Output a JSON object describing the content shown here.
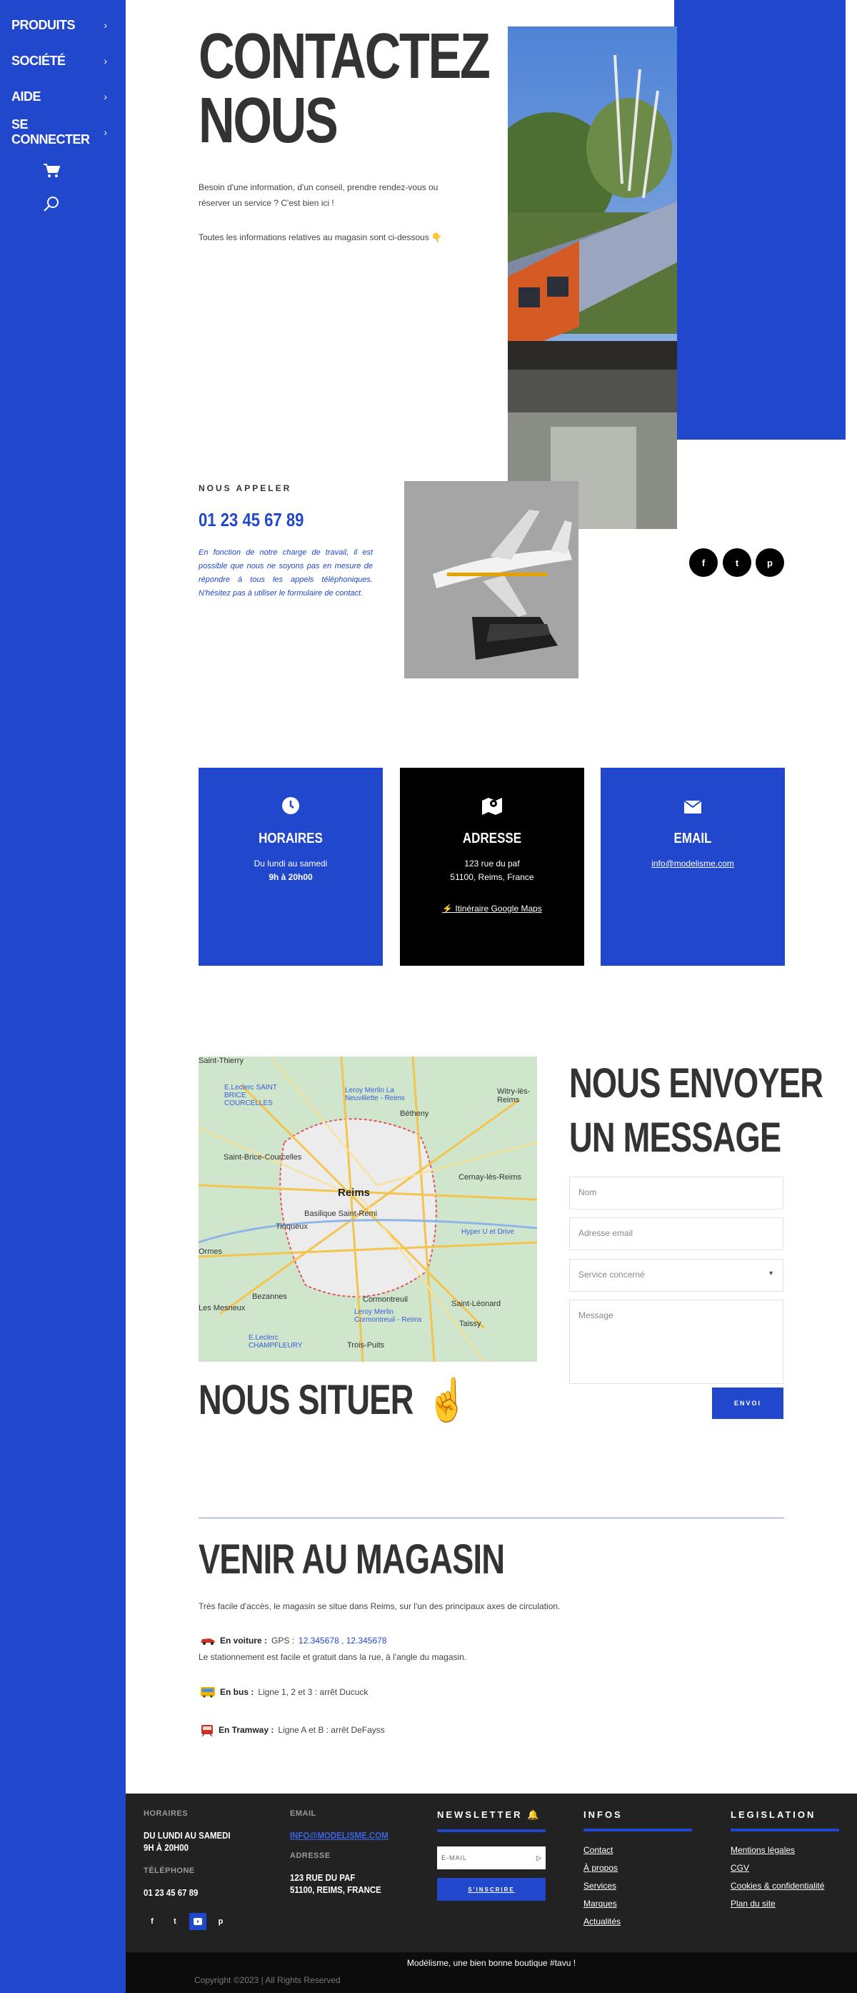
{
  "sidebar": {
    "items": [
      {
        "label": "PRODUITS"
      },
      {
        "label": "SOCIÉTÉ"
      },
      {
        "label": "AIDE"
      },
      {
        "label": "SE CONNECTER"
      }
    ],
    "chevron": "›",
    "icons": [
      "cart-icon",
      "search-icon"
    ]
  },
  "hero": {
    "title_line1": "CONTACTEZ",
    "title_line2": "NOUS",
    "intro_line1": "Besoin d'une information, d'un conseil, prendre rendez-vous ou",
    "intro_line2": "réserver un service ? C'est bien ici !",
    "info_line": "Toutes les informations relatives au magasin sont ci-dessous 👇"
  },
  "call": {
    "label": "NOUS APPELER",
    "phone": "01 23 45 67 89",
    "note": "En fonction de notre charge de travail, il est possible que nous ne soyons pas en mesure de répondre à tous les appels téléphoniques. N'hésitez pas à utiliser le formulaire de contact."
  },
  "social": [
    {
      "name": "facebook",
      "glyph": "f"
    },
    {
      "name": "twitter",
      "glyph": "t"
    },
    {
      "name": "pinterest",
      "glyph": "p"
    }
  ],
  "cards": {
    "horaires": {
      "title": "HORAIRES",
      "line1": "Du lundi au samedi",
      "line2": "9h à 20h00"
    },
    "adresse": {
      "title": "ADRESSE",
      "line1": "123 rue du paf",
      "line2": "51100, Reims, France",
      "link": "⚡ Itinéraire Google Maps"
    },
    "email": {
      "title": "EMAIL",
      "link": "info@modelisme.com"
    }
  },
  "map": {
    "labels": [
      "Saint-Thierry",
      "Witry-lès-Reims",
      "E.Leclerc SAINT BRICE COURCELLES",
      "Leroy Merlin La Neuvillette - Reims",
      "Bétheny",
      "Saint-Brice-Courcelles",
      "Reims",
      "Cernay-lès-Reims",
      "Basilique Saint-Remi",
      "Tinqueux",
      "Hyper U et Drive",
      "Ormes",
      "Bezannes",
      "Cormontreuil",
      "Saint-Léonard",
      "Les Mesneux",
      "Leroy Merlin Cormontreuil - Reims",
      "Taissy",
      "E.Leclerc CHAMPFLEURY",
      "Trois-Puits"
    ]
  },
  "contact_form": {
    "title_line1": "NOUS ENVOYER",
    "title_line2": "UN MESSAGE",
    "name_placeholder": "Nom",
    "email_placeholder": "Adresse email",
    "service_placeholder": "Service concerné",
    "message_placeholder": "Message",
    "submit": "ENVOI"
  },
  "situer": {
    "title": "NOUS SITUER",
    "emoji": "☝"
  },
  "venir": {
    "title": "VENIR AU MAGASIN",
    "intro": "Très facile d'accès, le magasin se situe dans Reims, sur l'un des principaux axes de circulation.",
    "car_label": "En voiture :",
    "car_gps": "GPS :",
    "car_coords": "12.345678 , 12.345678",
    "car_parking": "Le stationnement est facile et gratuit dans la rue, à l'angle du magasin.",
    "bus_label": "En bus :",
    "bus_text": "Ligne 1, 2 et 3 : arrêt Ducuck",
    "tram_label": "En Tramway :",
    "tram_text": "Ligne A et B : arrêt DeFayss"
  },
  "footer": {
    "horaires_label": "HORAIRES",
    "horaires_value1": "DU LUNDI AU SAMEDI",
    "horaires_value2": "9H À 20H00",
    "tel_label": "TÉLÉPHONE",
    "tel_value": "01 23 45 67 89",
    "email_label": "EMAIL",
    "email_value": "INFO@MODELISME.COM",
    "adresse_label": "ADRESSE",
    "adresse_value1": "123 RUE DU PAF",
    "adresse_value2": "51100, REIMS, FRANCE",
    "newsletter_title": "NEWSLETTER 🔔",
    "newsletter_placeholder": "E-MAIL",
    "newsletter_button": "S'INSCRIRE",
    "infos_title": "INFOS",
    "infos_links": [
      "Contact",
      "À propos",
      "Services",
      "Marques",
      "Actualités"
    ],
    "legal_title": "LEGISLATION",
    "legal_links": [
      "Mentions légales",
      "CGV",
      "Cookies & confidentialité",
      "Plan du site"
    ],
    "tagline": "Modélisme, une bien bonne boutique #tavu !",
    "copyright": "Copyright ©2023 | All Rights Reserved"
  },
  "colors": {
    "brand_blue": "#2147cc",
    "dark": "#222222",
    "black": "#000000"
  }
}
